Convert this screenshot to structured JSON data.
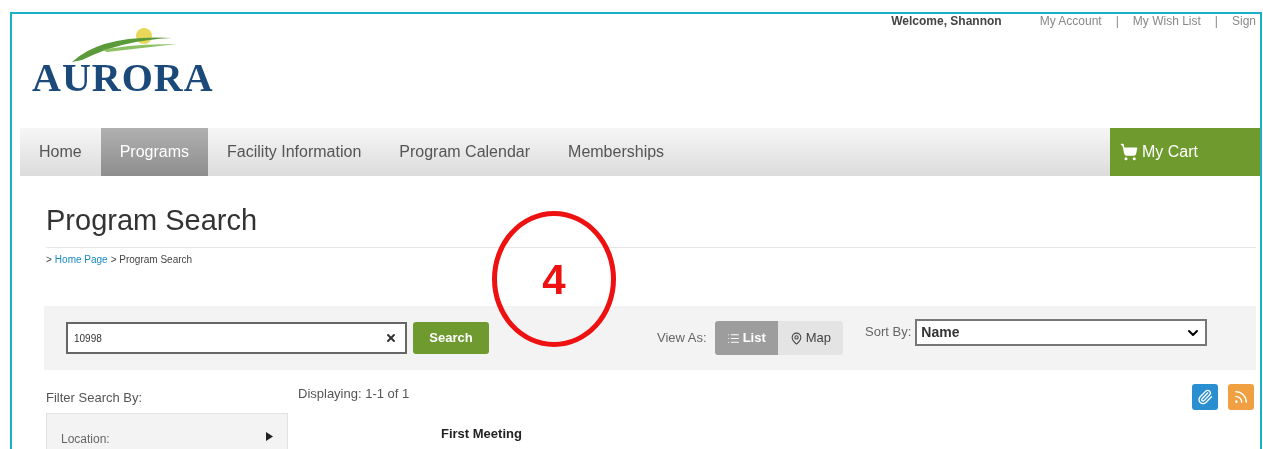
{
  "header": {
    "logo": "AURORA",
    "welcome": "Welcome, Shannon",
    "links": [
      {
        "label": "My Account"
      },
      {
        "label": "My Wish List"
      },
      {
        "label": "Sign"
      }
    ],
    "separator": "|"
  },
  "nav": {
    "items": [
      {
        "label": "Home",
        "selected": false
      },
      {
        "label": "Programs",
        "selected": true
      },
      {
        "label": "Facility Information",
        "selected": false
      },
      {
        "label": "Program Calendar",
        "selected": false
      },
      {
        "label": "Memberships",
        "selected": false
      }
    ],
    "cart": "My Cart"
  },
  "page_title": "Program Search",
  "breadcrumb": {
    "prefix": ">",
    "link": "Home Page",
    "current": "> Program Search"
  },
  "search": {
    "value": "10998",
    "button": "Search"
  },
  "annotation": {
    "label": "4"
  },
  "view_as": {
    "label": "View As:",
    "options": [
      {
        "label": "List",
        "kind": "list",
        "selected": true
      },
      {
        "label": "Map",
        "kind": "map",
        "selected": false
      }
    ]
  },
  "sort_by": {
    "label": "Sort By:",
    "value": "Name"
  },
  "filter_label": "Filter Search By:",
  "displaying": "Displaying: 1-1 of 1",
  "filters": [
    {
      "label": "Location:"
    }
  ],
  "results": {
    "column_1": "First Meeting"
  }
}
